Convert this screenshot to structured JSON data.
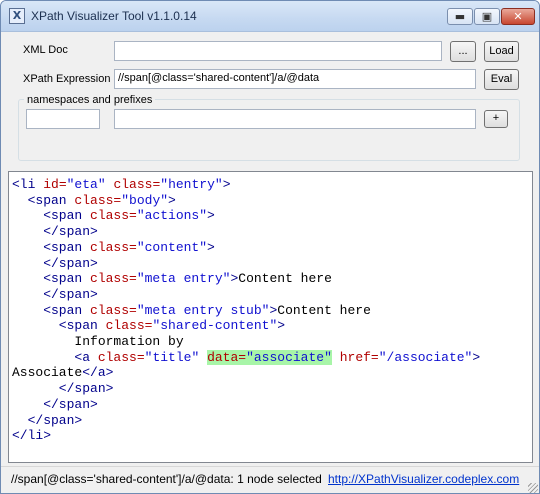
{
  "window": {
    "title": "XPath Visualizer Tool v1.1.0.14"
  },
  "titlebar_buttons": {
    "minimize": "▬",
    "maximize": "▣",
    "close": "✕"
  },
  "xml_doc": {
    "label": "XML Doc",
    "value": "",
    "browse_label": "...",
    "load_label": "Load"
  },
  "xpath": {
    "label": "XPath Expression",
    "value": "//span[@class='shared-content']/a/@data",
    "eval_label": "Eval"
  },
  "namespaces": {
    "label": "namespaces and prefixes",
    "prefix_value": "",
    "uri_value": "",
    "add_label": "+"
  },
  "editor": {
    "lines": [
      [
        [
          "t",
          "<li "
        ],
        [
          "a",
          "id="
        ],
        [
          "v",
          "\"eta\""
        ],
        [
          "t",
          " "
        ],
        [
          "a",
          "class="
        ],
        [
          "v",
          "\"hentry\""
        ],
        [
          "t",
          ">"
        ]
      ],
      [
        [
          "t",
          "  <span "
        ],
        [
          "a",
          "class="
        ],
        [
          "v",
          "\"body\""
        ],
        [
          "t",
          ">"
        ]
      ],
      [
        [
          "t",
          "    <span "
        ],
        [
          "a",
          "class="
        ],
        [
          "v",
          "\"actions\""
        ],
        [
          "t",
          ">"
        ]
      ],
      [
        [
          "t",
          "    </span>"
        ]
      ],
      [
        [
          "t",
          "    <span "
        ],
        [
          "a",
          "class="
        ],
        [
          "v",
          "\"content\""
        ],
        [
          "t",
          ">"
        ]
      ],
      [
        [
          "t",
          "    </span>"
        ]
      ],
      [
        [
          "t",
          "    <span "
        ],
        [
          "a",
          "class="
        ],
        [
          "v",
          "\"meta entry\""
        ],
        [
          "t",
          ">"
        ],
        [
          "x",
          "Content here"
        ]
      ],
      [
        [
          "t",
          "    </span>"
        ]
      ],
      [
        [
          "t",
          "    <span "
        ],
        [
          "a",
          "class="
        ],
        [
          "v",
          "\"meta entry stub\""
        ],
        [
          "t",
          ">"
        ],
        [
          "x",
          "Content here"
        ]
      ],
      [
        [
          "t",
          "      <span "
        ],
        [
          "a",
          "class="
        ],
        [
          "v",
          "\"shared-content\""
        ],
        [
          "t",
          ">"
        ]
      ],
      [
        [
          "x",
          "        Information by"
        ]
      ],
      [
        [
          "t",
          "        <a "
        ],
        [
          "a",
          "class="
        ],
        [
          "v",
          "\"title\""
        ],
        [
          "x",
          " "
        ],
        [
          "ha",
          "data="
        ],
        [
          "hv",
          "\"associate\""
        ],
        [
          "x",
          " "
        ],
        [
          "a",
          "href="
        ],
        [
          "v",
          "\"/associate\""
        ],
        [
          "t",
          ">"
        ]
      ],
      [
        [
          "x",
          "Associate"
        ],
        [
          "t",
          "</a>"
        ]
      ],
      [
        [
          "t",
          "      </span>"
        ]
      ],
      [
        [
          "t",
          "    </span>"
        ]
      ],
      [
        [
          "t",
          "  </span>"
        ]
      ],
      [
        [
          "t",
          "</li>"
        ]
      ]
    ]
  },
  "status": {
    "text": "//span[@class='shared-content']/a/@data: 1 node selected",
    "link": "http://XPathVisualizer.codeplex.com"
  }
}
